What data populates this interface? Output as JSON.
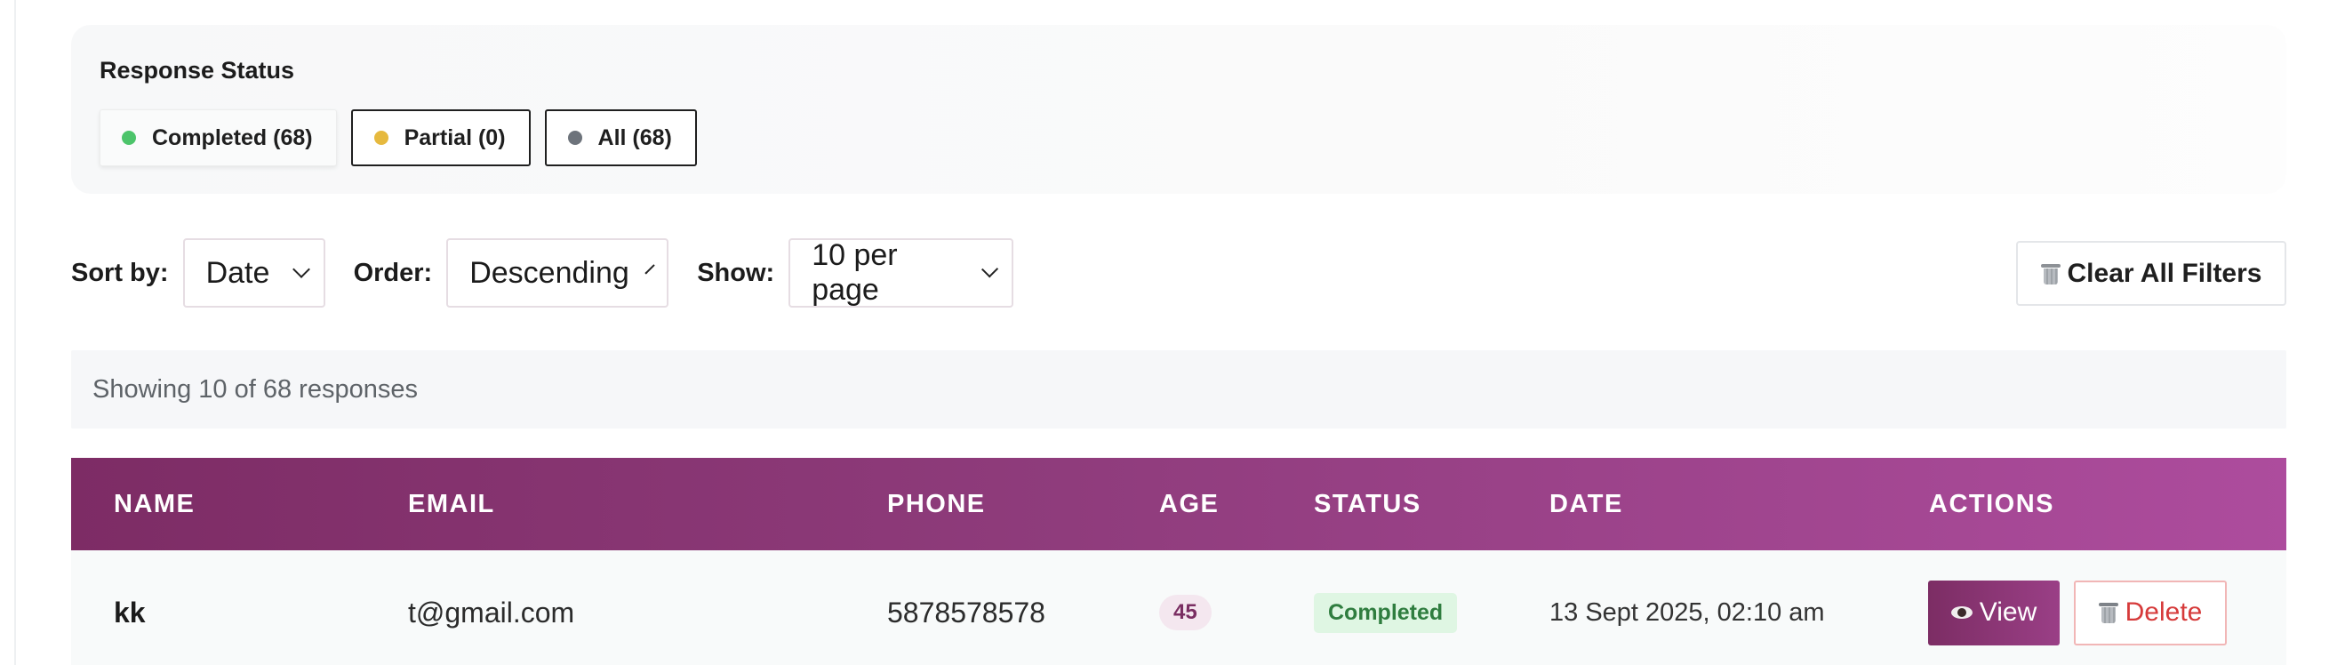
{
  "filter_panel": {
    "title": "Response Status",
    "chips": [
      {
        "label": "Completed (68)",
        "dot_color": "#4cc46a",
        "active": true
      },
      {
        "label": "Partial (0)",
        "dot_color": "#e6b93e",
        "active": false
      },
      {
        "label": "All (68)",
        "dot_color": "#6d737b",
        "active": false
      }
    ]
  },
  "toolbar": {
    "sort_label": "Sort by:",
    "sort_value": "Date",
    "order_label": "Order:",
    "order_value": "Descending",
    "show_label": "Show:",
    "show_value": "10 per page",
    "clear_label": "Clear All Filters",
    "clear_icon": "trash-icon"
  },
  "results": {
    "summary": "Showing 10 of 68 responses"
  },
  "table": {
    "header_gradient": [
      "#7d2c65",
      "#ad4c9d"
    ],
    "columns": [
      "NAME",
      "EMAIL",
      "PHONE",
      "AGE",
      "STATUS",
      "DATE",
      "ACTIONS"
    ],
    "rows": [
      {
        "name": "kk",
        "email": "t@gmail.com",
        "phone": "5878578578",
        "age": "45",
        "status": "Completed",
        "date": "13 Sept 2025, 02:10 am",
        "view_label": "View",
        "view_icon": "eye-icon",
        "delete_label": "Delete",
        "delete_icon": "trash-icon"
      }
    ]
  },
  "colors": {
    "accent": "#8f3c7c",
    "completed_badge_bg": "#dff6e3",
    "completed_badge_text": "#2f7d3f",
    "delete_text": "#d63a3a"
  }
}
